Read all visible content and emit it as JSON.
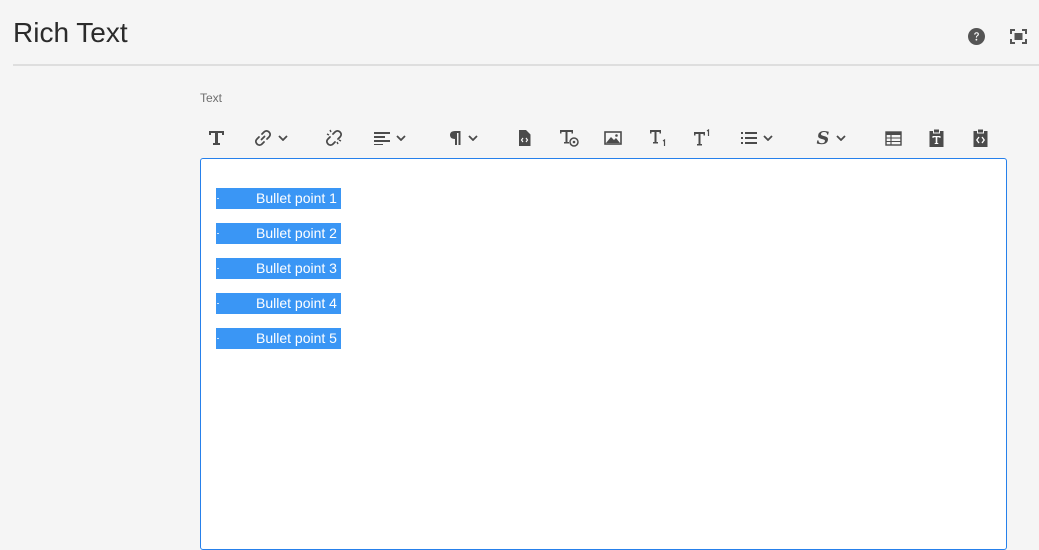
{
  "header": {
    "title": "Rich Text",
    "help_icon": "help-circle-icon",
    "fullscreen_icon": "fullscreen-icon"
  },
  "field": {
    "label": "Text"
  },
  "toolbar": {
    "buttons": [
      {
        "name": "format-text",
        "icon": "text-format-icon"
      },
      {
        "name": "link",
        "icon": "link-icon",
        "dropdown": true
      },
      {
        "name": "unlink",
        "icon": "unlink-icon"
      },
      {
        "name": "justify",
        "icon": "align-left-icon",
        "dropdown": true
      },
      {
        "name": "paragraph",
        "icon": "paragraph-icon",
        "dropdown": true
      },
      {
        "name": "source-edit",
        "icon": "source-file-icon"
      },
      {
        "name": "special-char",
        "icon": "text-special-icon"
      },
      {
        "name": "image",
        "icon": "image-icon"
      },
      {
        "name": "subscript",
        "icon": "subscript-icon"
      },
      {
        "name": "superscript",
        "icon": "superscript-icon"
      },
      {
        "name": "lists",
        "icon": "bullet-list-icon",
        "dropdown": true
      },
      {
        "name": "styles",
        "icon": "styles-icon",
        "dropdown": true
      },
      {
        "name": "table",
        "icon": "table-icon"
      },
      {
        "name": "paste-text",
        "icon": "paste-text-icon"
      },
      {
        "name": "paste-code",
        "icon": "paste-code-icon"
      }
    ]
  },
  "editor": {
    "items": [
      "Bullet point 1",
      "Bullet point 2",
      "Bullet point 3",
      "Bullet point 4",
      "Bullet point 5"
    ],
    "selection_color": "#3a96f5",
    "border_color": "#2680eb"
  }
}
